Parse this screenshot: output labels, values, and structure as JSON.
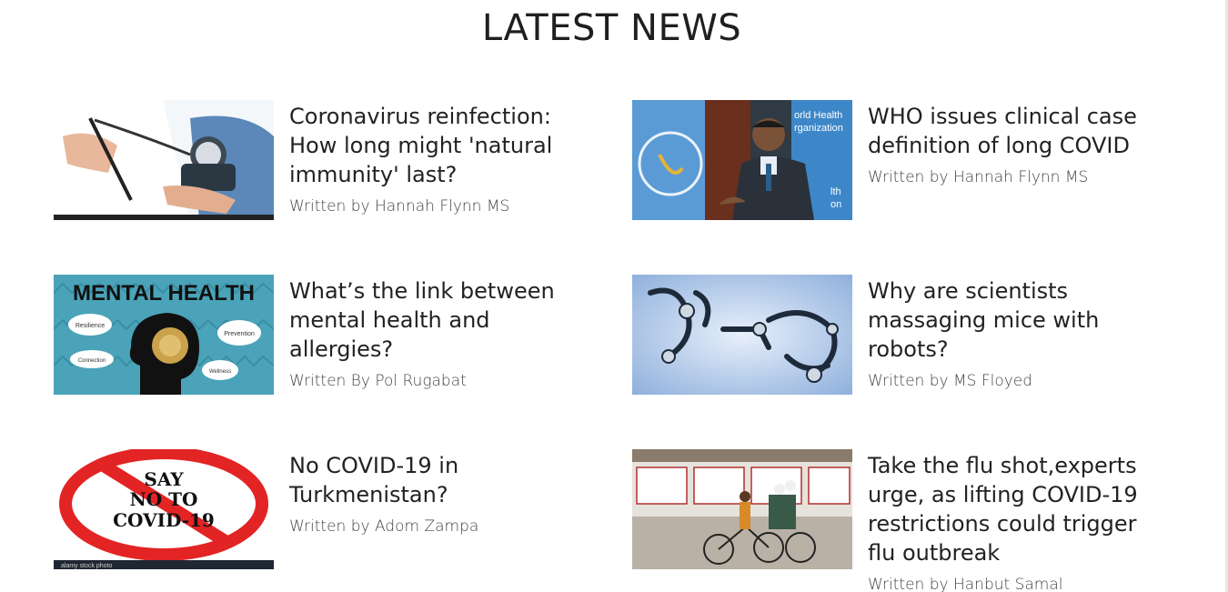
{
  "section": {
    "title": "LATEST NEWS"
  },
  "articles": [
    {
      "headline": "Coronavirus reinfection: How long might 'natural immunity' last?",
      "byline": "Written by Hannah Flynn MS",
      "image_icon": "blood-pressure-photo"
    },
    {
      "headline": "WHO issues clinical case definition of long COVID",
      "byline": "Written by Hannah Flynn MS",
      "image_icon": "who-speaker-photo",
      "image_text": [
        "orld Health",
        "rganization",
        "lth",
        "on"
      ]
    },
    {
      "headline": "What’s the link between mental health and allergies?",
      "byline": "Written By Pol Rugabat",
      "image_icon": "mental-health-illustration",
      "image_text": [
        "MENTAL HEALTH",
        "Resilience",
        "Prevention",
        "Connection",
        "Wellness"
      ]
    },
    {
      "headline": "Why are scientists massaging mice with robots?",
      "byline": "Written by MS Floyed",
      "image_icon": "robot-arms-illustration"
    },
    {
      "headline": "No COVID-19 in Turkmenistan?",
      "byline": "Written by Adom Zampa",
      "image_icon": "no-covid-sign",
      "image_text": [
        "SAY",
        "NO TO",
        "COVID-19",
        "alamy stock photo"
      ]
    },
    {
      "headline": "Take the flu shot,experts urge, as lifting COVID-19 restrictions could trigger flu outbreak",
      "byline": "Written by Hanbut Samal",
      "image_icon": "rickshaw-street-photo"
    }
  ]
}
